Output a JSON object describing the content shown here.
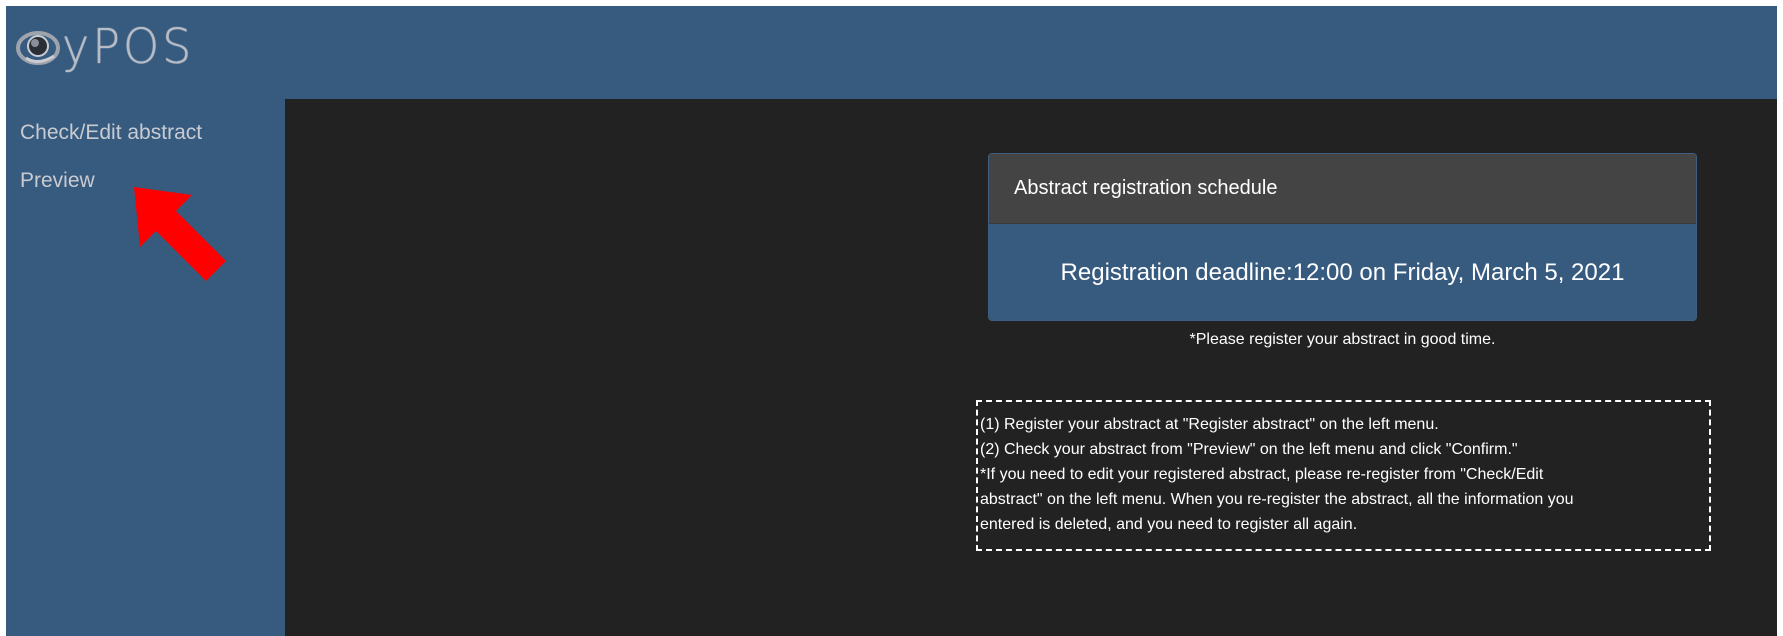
{
  "app": {
    "logo_text": "yPOS",
    "logo_icon": "globe-ring-logo"
  },
  "sidebar": {
    "items": [
      {
        "label": "Check/Edit abstract"
      },
      {
        "label": "Preview"
      }
    ],
    "pointer_icon": "red-arrow-icon"
  },
  "schedule": {
    "title": "Abstract registration schedule",
    "deadline": "Registration deadline:12:00 on Friday, March 5, 2021",
    "note": "*Please register your abstract in good time."
  },
  "instructions": {
    "lines": [
      "(1) Register your abstract at \"Register abstract\" on the left menu.",
      "(2) Check your abstract from \"Preview\" on the left menu and click \"Confirm.\"",
      "*If you need to edit your registered abstract, please re-register from \"Check/Edit",
      "abstract\" on the left menu. When you re-register the abstract, all the information you",
      "entered is deleted, and you need to register all again."
    ]
  },
  "colors": {
    "header_bg": "#375a7f",
    "main_bg": "#222222",
    "card_header_bg": "#444444",
    "arrow": "#ff0000"
  }
}
